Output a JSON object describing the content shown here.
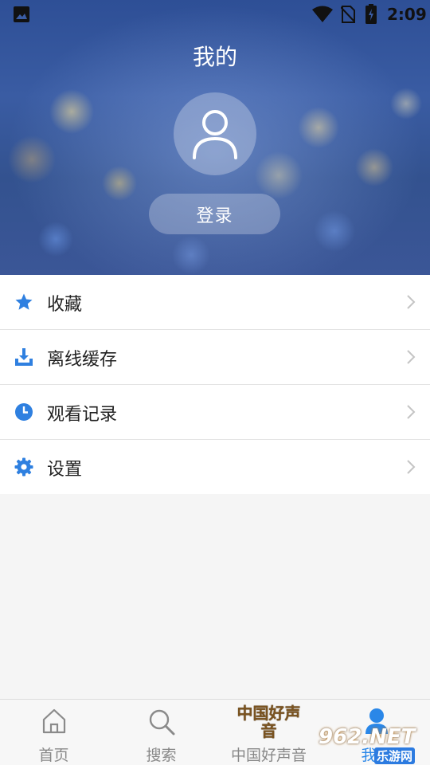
{
  "status_bar": {
    "time": "2:09",
    "icons": [
      "gallery-icon",
      "wifi-icon",
      "no-sim-icon",
      "battery-charging-icon"
    ]
  },
  "header": {
    "title": "我的",
    "avatar_icon": "user-outline-icon",
    "login_label": "登录"
  },
  "menu": {
    "items": [
      {
        "label": "收藏",
        "icon": "star-icon"
      },
      {
        "label": "离线缓存",
        "icon": "download-icon"
      },
      {
        "label": "观看记录",
        "icon": "clock-icon"
      },
      {
        "label": "设置",
        "icon": "gear-icon"
      }
    ]
  },
  "bottom_nav": {
    "items": [
      {
        "label": "首页",
        "icon": "home-icon"
      },
      {
        "label": "搜索",
        "icon": "search-icon"
      },
      {
        "label": "中国好声音",
        "icon": "brand-logo",
        "logo_text": "中国好声音"
      },
      {
        "label": "我的",
        "icon": "user-icon",
        "active": true
      }
    ]
  },
  "watermark": {
    "top": "962.NET",
    "bottom": "乐游网"
  },
  "colors": {
    "accent": "#2a87e8",
    "icon_blue": "#2f80e0",
    "menu_text": "#222222",
    "nav_inactive": "#888888",
    "page_bg": "#f5f5f5"
  }
}
